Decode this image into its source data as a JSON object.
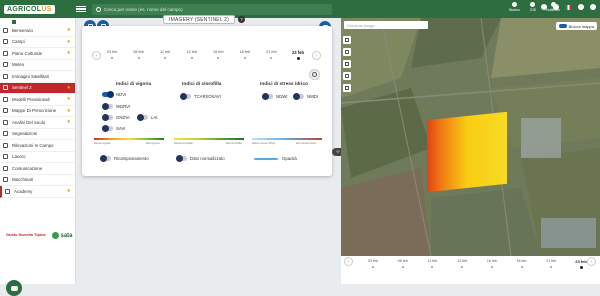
{
  "header": {
    "logo_text_a": "AGRICOL",
    "logo_text_b": "US",
    "search_placeholder": "Cerca per nome (es. nome del campo)",
    "icons": [
      {
        "label": "Storico",
        "icon": "history-icon"
      },
      {
        "label": "GIS",
        "icon": "gis-icon"
      },
      {
        "label": "Notifiche",
        "icon": "bell-icon"
      }
    ]
  },
  "sidebar": {
    "items": [
      {
        "label": "Benvenuto",
        "star": true,
        "icon": "home-icon"
      },
      {
        "label": "Campi",
        "star": true,
        "icon": "fields-icon"
      },
      {
        "label": "Piano Colturale",
        "star": true,
        "icon": "crop-plan-icon"
      },
      {
        "label": "Meteo",
        "star": false,
        "icon": "weather-icon"
      },
      {
        "label": "Immagini Satellitari",
        "star": false,
        "icon": "satellite-icon"
      },
      {
        "label": "Sentinel 2",
        "star": true,
        "icon": "sentinel-icon",
        "active": true
      },
      {
        "label": "Modelli Previsionali",
        "star": true,
        "icon": "models-icon"
      },
      {
        "label": "Mappe Di Prescrizione",
        "star": true,
        "icon": "prescription-icon"
      },
      {
        "label": "Analisi Del Suolo",
        "star": true,
        "icon": "soil-icon"
      },
      {
        "label": "Segnalazioni",
        "star": false,
        "icon": "report-icon"
      },
      {
        "label": "Rilevazioni In Campo",
        "star": false,
        "icon": "survey-icon"
      },
      {
        "label": "Lavoro",
        "star": false,
        "icon": "work-icon"
      },
      {
        "label": "Comunicazione",
        "star": false,
        "icon": "message-icon"
      },
      {
        "label": "Macchinari",
        "star": false,
        "icon": "tractor-icon"
      },
      {
        "label": "Academy",
        "star": true,
        "icon": "academy-icon"
      }
    ],
    "logo_left": "Gusto Novella Tipica",
    "logo_right": "sata"
  },
  "panel": {
    "title": "IMAGERY (SENTINEL 2)",
    "help": "?",
    "dates": [
      "03 feb",
      "08 feb",
      "11 feb",
      "13 feb",
      "16 feb",
      "18 feb",
      "21 feb",
      "23 feb"
    ],
    "selected_date": "23 feb",
    "vigor": {
      "title": "Indici di vigoria",
      "items": [
        {
          "label": "NDVI",
          "on": true
        },
        {
          "label": "WDRVI",
          "on": false
        },
        {
          "label": "GNDVI",
          "on": false
        },
        {
          "label": "LAI",
          "on": false
        },
        {
          "label": "SAVI",
          "on": false
        }
      ],
      "low": "bassa vigoria",
      "high": "alta vigoria"
    },
    "chloro": {
      "title": "Indici di clorofilla",
      "items": [
        {
          "label": "TCARI/OSAVI",
          "on": false
        }
      ],
      "low": "bassa clorofilla",
      "high": "alta clorofilla"
    },
    "water": {
      "title": "Indici di stress idrico",
      "items": [
        {
          "label": "NDWI",
          "on": false
        },
        {
          "label": "NMDI",
          "on": false
        }
      ],
      "low": "basso stress idrico",
      "high": "alto stress idrico"
    },
    "options": {
      "resample": "Ricampionamento",
      "normalized": "Dato normalizzato",
      "opacity": "Opacità"
    }
  },
  "map": {
    "search_placeholder": "Cerca un luogo...",
    "lock_label": "Blocca mappa"
  },
  "colors": {
    "brand": "#2c6e3f",
    "active": "#c2272d",
    "accent": "#1a5ea8"
  }
}
